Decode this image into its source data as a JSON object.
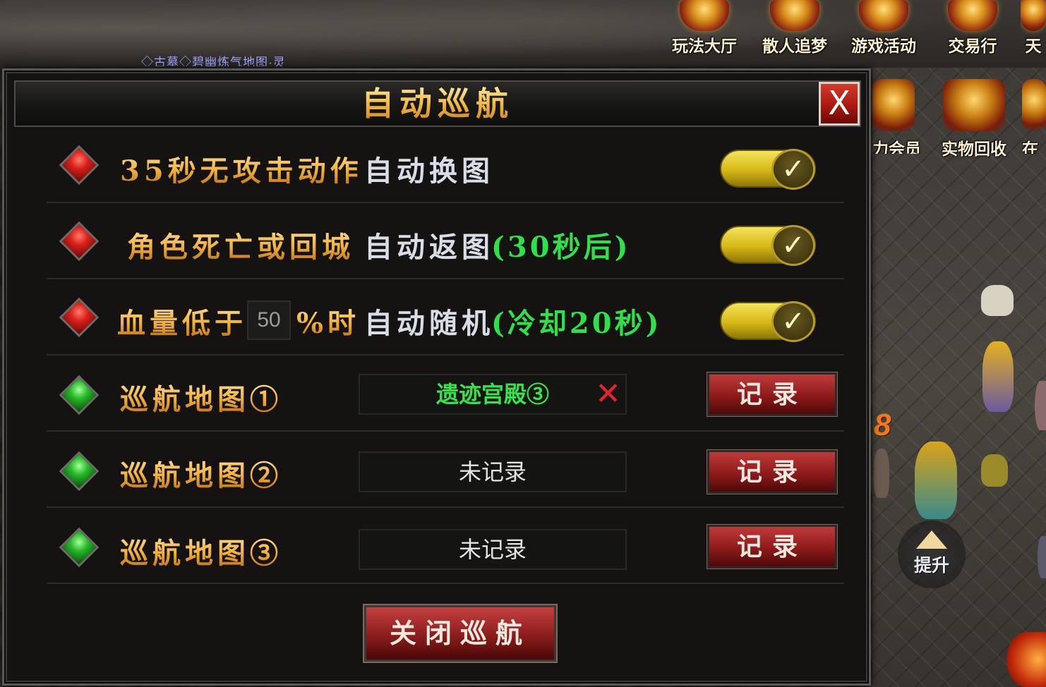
{
  "background": {
    "chat_text": "◇古墓◇碧幽炼气地图·灵",
    "top_menu": [
      {
        "label": "玩法大厅",
        "icon": "game-hall-icon"
      },
      {
        "label": "散人追梦",
        "icon": "solo-dream-icon"
      },
      {
        "label": "游戏活动",
        "icon": "game-event-icon"
      },
      {
        "label": "交易行",
        "icon": "trading-house-icon"
      },
      {
        "label": "天",
        "icon": "sky-icon"
      }
    ],
    "side_menu": [
      {
        "label": "力会员",
        "icon": "vip-member-icon"
      },
      {
        "label": "实物回收",
        "icon": "item-recycle-icon"
      },
      {
        "label": "在",
        "icon": "online-icon"
      }
    ],
    "damage_number": "8",
    "upgrade_label": "提升"
  },
  "panel": {
    "title": "自动巡航",
    "close_label": "X",
    "rows": {
      "r1": {
        "label": "35秒无攻击动作",
        "action": "自动换图",
        "note": "",
        "enabled": true,
        "check": "✓"
      },
      "r2": {
        "label": "角色死亡或回城",
        "action": "自动返图",
        "note": "(30秒后)",
        "enabled": true,
        "check": "✓"
      },
      "r3": {
        "label_prefix": "血量低于",
        "hp_value": "50",
        "label_suffix": "%时",
        "action": "自动随机",
        "note": "(冷却20秒)",
        "enabled": true,
        "check": "✓"
      }
    },
    "maps": [
      {
        "label": "巡航地图①",
        "value": "遗迹宫殿③",
        "recorded": true,
        "clear_icon": "✕",
        "button": "记录"
      },
      {
        "label": "巡航地图②",
        "value": "未记录",
        "recorded": false,
        "button": "记录"
      },
      {
        "label": "巡航地图③",
        "value": "未记录",
        "recorded": false,
        "button": "记录"
      }
    ],
    "stop_button": "关闭巡航"
  },
  "colors": {
    "gold": "#f3b640",
    "green_note": "#2ee04a",
    "red_button": "#8d1a1a",
    "toggle_on": "#d6b816"
  }
}
